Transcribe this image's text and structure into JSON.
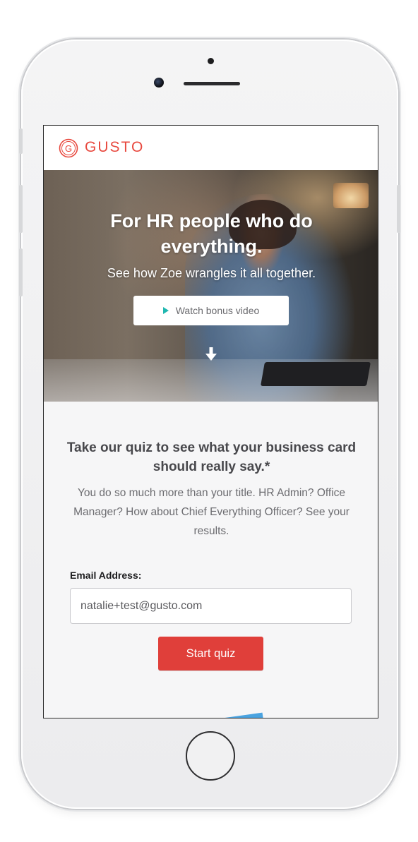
{
  "header": {
    "logo_text": "GUSTO",
    "logo_mark": "G"
  },
  "hero": {
    "title": "For HR people who do everything.",
    "subtitle": "See how Zoe wrangles it all together.",
    "video_button_label": "Watch bonus video",
    "scroll_icon": "arrow-down-icon"
  },
  "quiz": {
    "title": "Take our quiz to see what your business card should really say.*",
    "description": "You do so much more than your title. HR Admin? Office Manager? How about Chief Everything Officer? See your results.",
    "email_label": "Email Address:",
    "email_value": "natalie+test@gusto.com",
    "start_button_label": "Start quiz"
  },
  "colors": {
    "brand": "#e8493f",
    "start_button": "#e03f3a",
    "play_icon": "#1fb7b0"
  }
}
